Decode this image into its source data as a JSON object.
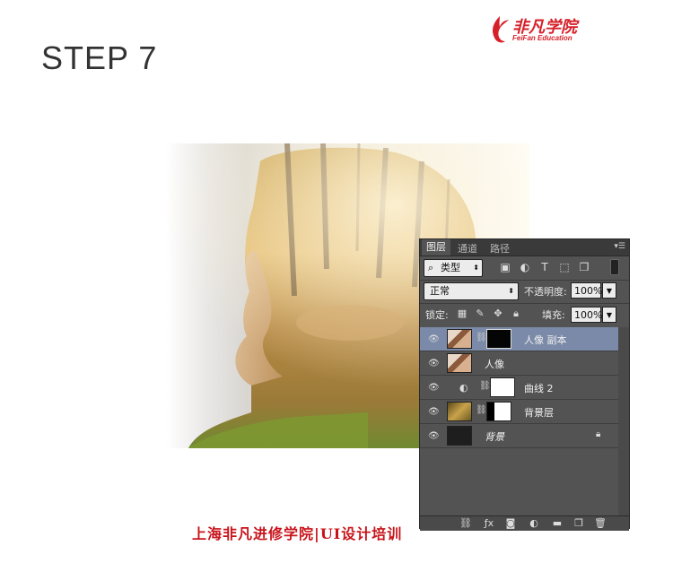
{
  "page": {
    "step_title": "STEP 7"
  },
  "logo": {
    "cn": "非凡学院",
    "en": "FeiFan Education"
  },
  "footer": {
    "text": "上海非凡进修学院|UI设计培训"
  },
  "panel": {
    "tabs": [
      {
        "label": "图层",
        "active": true
      },
      {
        "label": "通道",
        "active": false
      },
      {
        "label": "路径",
        "active": false
      }
    ],
    "filter": {
      "kind_label": "类型"
    },
    "blend_mode": "正常",
    "opacity_label": "不透明度:",
    "opacity_value": "100%",
    "lock_label": "锁定:",
    "fill_label": "填充:",
    "fill_value": "100%",
    "layers": [
      {
        "name": "人像 副本",
        "selected": true,
        "italic": false
      },
      {
        "name": "人像",
        "selected": false,
        "italic": false
      },
      {
        "name": "曲线 2",
        "selected": false,
        "italic": false
      },
      {
        "name": "背景层",
        "selected": false,
        "italic": false
      },
      {
        "name": "背景",
        "selected": false,
        "italic": true,
        "locked": true
      }
    ]
  },
  "colors": {
    "brand_red": "#d6202a",
    "panel_bg": "#535353",
    "selection": "#7a8aa8"
  }
}
